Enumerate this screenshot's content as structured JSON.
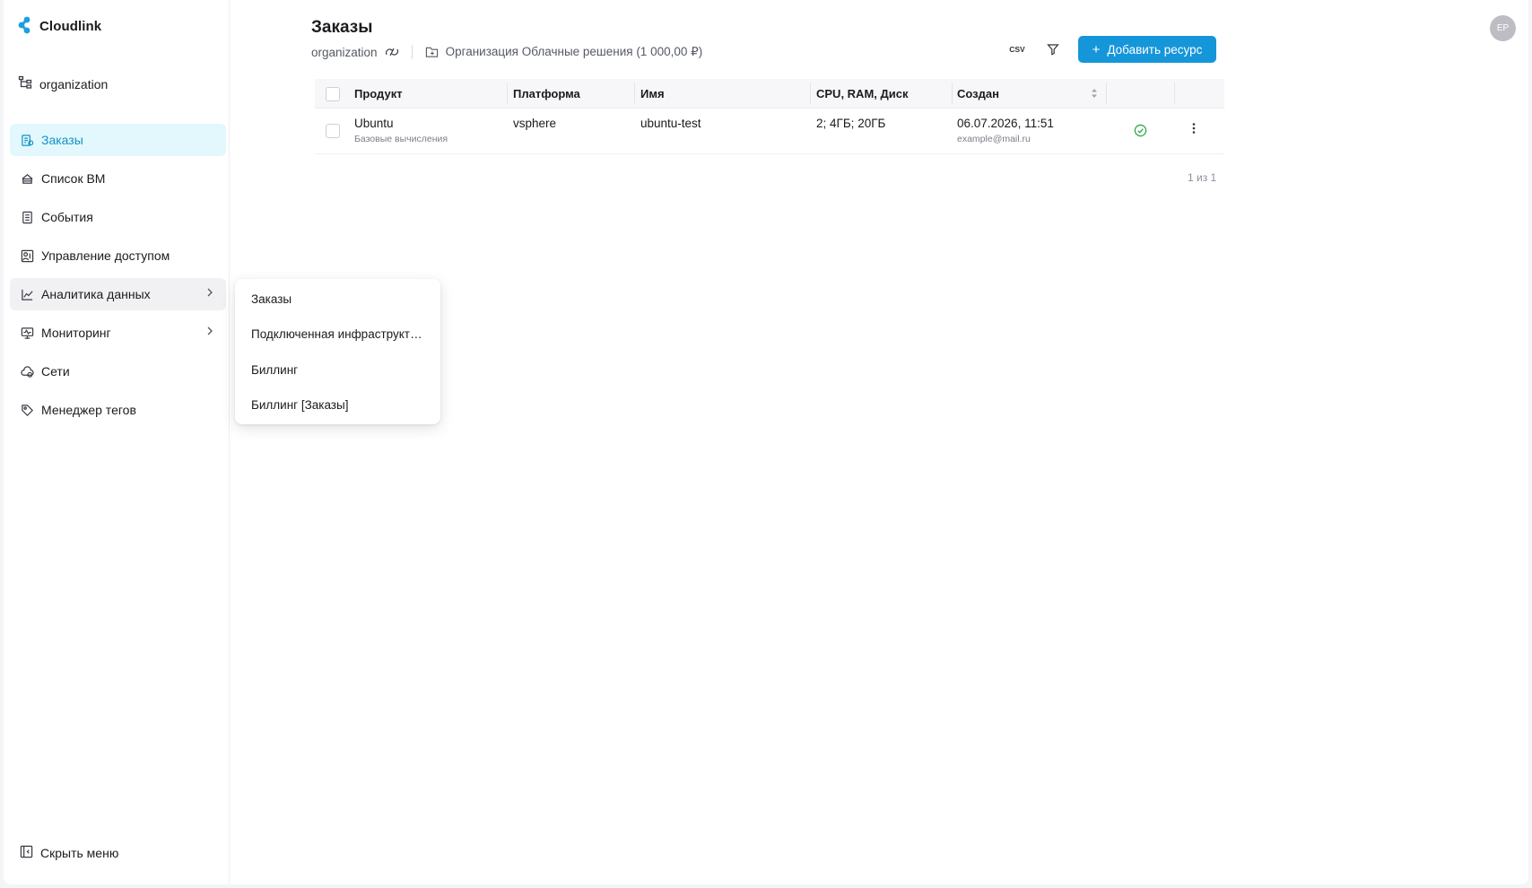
{
  "app": {
    "name": "Cloudlink"
  },
  "sidebar": {
    "org": "organization",
    "items": [
      {
        "label": "Заказы",
        "icon": "orders-icon",
        "active": true
      },
      {
        "label": "Список ВМ",
        "icon": "vm-list-icon"
      },
      {
        "label": "События",
        "icon": "events-icon"
      },
      {
        "label": "Управление доступом",
        "icon": "access-icon"
      },
      {
        "label": "Аналитика данных",
        "icon": "analytics-icon",
        "has_children": true
      },
      {
        "label": "Мониторинг",
        "icon": "monitoring-icon",
        "has_children": true
      },
      {
        "label": "Сети",
        "icon": "networks-icon"
      },
      {
        "label": "Менеджер тегов",
        "icon": "tag-icon"
      }
    ],
    "hide_menu": "Скрыть меню"
  },
  "header": {
    "title": "Заказы",
    "breadcrumb_org": "organization",
    "breadcrumb_project": "Организация Облачные решения (1 000,00 ₽)",
    "csv_label": "CSV",
    "add_label": "Добавить ресурс",
    "avatar": "ЕР"
  },
  "table": {
    "columns": [
      "Продукт",
      "Платформа",
      "Имя",
      "CPU, RAM, Диск",
      "Создан"
    ],
    "rows": [
      {
        "product": "Ubuntu",
        "product_sub": "Базовые вычисления",
        "platform": "vsphere",
        "name": "ubuntu-test",
        "resources": "2; 4ГБ; 20ГБ",
        "created": "06.07.2026, 11:51",
        "created_by": "example@mail.ru",
        "status": "ok"
      }
    ],
    "pager": "1 из 1"
  },
  "submenu": {
    "items": [
      "Заказы",
      "Подключенная инфраструктура",
      "Биллинг",
      "Биллинг [Заказы]"
    ]
  },
  "colors": {
    "accent": "#1596d9",
    "active_bg": "#e2f8fd",
    "success": "#2eaa4a"
  }
}
